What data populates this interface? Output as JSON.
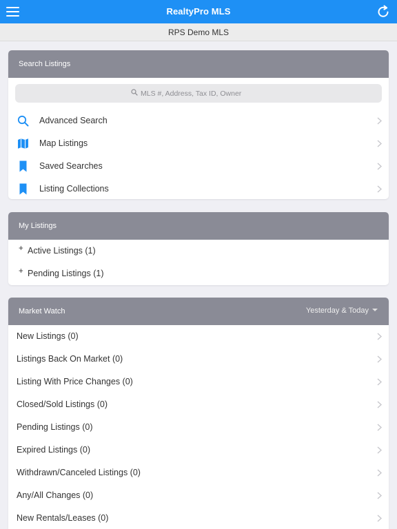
{
  "app": {
    "title": "RealtyPro MLS"
  },
  "subheader": {
    "mls_name": "RPS Demo MLS"
  },
  "search_listings": {
    "header": "Search Listings",
    "search_placeholder": "MLS #, Address, Tax ID, Owner",
    "items": [
      {
        "label": "Advanced Search",
        "icon": "search-icon"
      },
      {
        "label": "Map Listings",
        "icon": "map-icon"
      },
      {
        "label": "Saved Searches",
        "icon": "bookmark-icon"
      },
      {
        "label": "Listing Collections",
        "icon": "bookmark-icon"
      }
    ]
  },
  "my_listings": {
    "header": "My Listings",
    "items": [
      {
        "label": "Active Listings (1)"
      },
      {
        "label": "Pending Listings (1)"
      }
    ]
  },
  "market_watch": {
    "header": "Market Watch",
    "filter": "Yesterday & Today",
    "items": [
      {
        "label": "New Listings (0)"
      },
      {
        "label": "Listings Back On Market (0)"
      },
      {
        "label": "Listing With Price Changes (0)"
      },
      {
        "label": "Closed/Sold Listings (0)"
      },
      {
        "label": "Pending Listings (0)"
      },
      {
        "label": "Expired Listings (0)"
      },
      {
        "label": "Withdrawn/Canceled Listings (0)"
      },
      {
        "label": "Any/All Changes (0)"
      },
      {
        "label": "New Rentals/Leases (0)"
      }
    ]
  },
  "colors": {
    "accent": "#1e90f5",
    "header_gray": "#8a8b96",
    "background": "#efeff4"
  }
}
